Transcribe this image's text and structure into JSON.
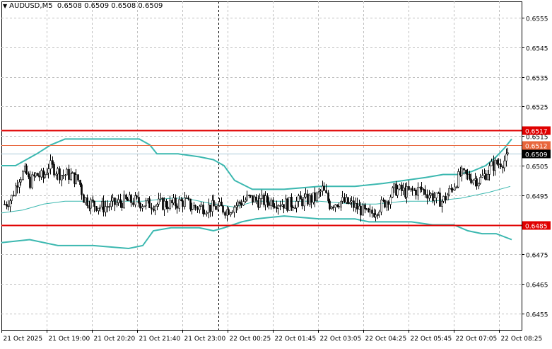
{
  "header": {
    "symbol": "AUDUSD,M5",
    "ohlc": "0.6508 0.6509 0.6508 0.6509"
  },
  "colors": {
    "background": "#ffffff",
    "grid": "#c0c0c0",
    "candle": "#000000",
    "bands": "#3cb8b0",
    "level_line": "#e00000",
    "level_line_thin": "#e8663c",
    "bid_line": "#a8c8d8"
  },
  "chart_data": {
    "type": "candlestick",
    "title": "AUDUSD,M5",
    "ylim": [
      0.64495,
      0.65605
    ],
    "grid": true,
    "y_ticks": [
      "0.6555",
      "0.6545",
      "0.6535",
      "0.6525",
      "0.6515",
      "0.6505",
      "0.6495",
      "0.6485",
      "0.6475",
      "0.6465",
      "0.6455"
    ],
    "x_ticks": [
      "21 Oct 2025",
      "21 Oct 19:00",
      "21 Oct 20:20",
      "21 Oct 21:40",
      "21 Oct 23:00",
      "22 Oct 00:25",
      "22 Oct 01:45",
      "22 Oct 03:05",
      "22 Oct 04:25",
      "22 Oct 05:45",
      "22 Oct 07:05",
      "22 Oct 08:25"
    ],
    "levels": [
      {
        "value": 0.6517,
        "label": "0.6517",
        "style": "thick"
      },
      {
        "value": 0.6512,
        "label": "0.6512",
        "style": "thin"
      },
      {
        "value": 0.6485,
        "label": "0.6485",
        "style": "thick"
      }
    ],
    "current_price": {
      "value": 0.6509,
      "label": "0.6509"
    },
    "session_separator": "21 Oct 23:00",
    "price_path": [
      [
        0,
        0.6492
      ],
      [
        10,
        0.6494
      ],
      [
        20,
        0.6501
      ],
      [
        30,
        0.6503
      ],
      [
        35,
        0.6499
      ],
      [
        45,
        0.6502
      ],
      [
        55,
        0.6501
      ],
      [
        62,
        0.6505
      ],
      [
        70,
        0.6504
      ],
      [
        80,
        0.6502
      ],
      [
        90,
        0.6502
      ],
      [
        105,
        0.65
      ],
      [
        112,
        0.6494
      ],
      [
        125,
        0.6492
      ],
      [
        140,
        0.6491
      ],
      [
        155,
        0.6492
      ],
      [
        170,
        0.6493
      ],
      [
        185,
        0.6493
      ],
      [
        200,
        0.6492
      ],
      [
        220,
        0.6492
      ],
      [
        240,
        0.6492
      ],
      [
        255,
        0.6493
      ],
      [
        265,
        0.6491
      ],
      [
        280,
        0.6491
      ],
      [
        300,
        0.6491
      ],
      [
        315,
        0.649
      ],
      [
        330,
        0.6492
      ],
      [
        345,
        0.6494
      ],
      [
        360,
        0.6493
      ],
      [
        380,
        0.6493
      ],
      [
        400,
        0.6492
      ],
      [
        420,
        0.6493
      ],
      [
        440,
        0.6494
      ],
      [
        450,
        0.6497
      ],
      [
        460,
        0.6492
      ],
      [
        475,
        0.6493
      ],
      [
        490,
        0.6492
      ],
      [
        505,
        0.649
      ],
      [
        515,
        0.6488
      ],
      [
        525,
        0.649
      ],
      [
        540,
        0.6493
      ],
      [
        552,
        0.6497
      ],
      [
        570,
        0.6496
      ],
      [
        590,
        0.6497
      ],
      [
        610,
        0.6494
      ],
      [
        620,
        0.6493
      ],
      [
        632,
        0.6497
      ],
      [
        645,
        0.6502
      ],
      [
        660,
        0.6501
      ],
      [
        672,
        0.65
      ],
      [
        680,
        0.6502
      ],
      [
        690,
        0.6505
      ],
      [
        700,
        0.6506
      ],
      [
        710,
        0.6507
      ],
      [
        715,
        0.6509
      ]
    ],
    "bollinger_upper": [
      [
        0,
        0.6505
      ],
      [
        20,
        0.6505
      ],
      [
        50,
        0.6509
      ],
      [
        70,
        0.6512
      ],
      [
        90,
        0.6514
      ],
      [
        110,
        0.6514
      ],
      [
        195,
        0.6514
      ],
      [
        210,
        0.6512
      ],
      [
        220,
        0.6509
      ],
      [
        250,
        0.6509
      ],
      [
        280,
        0.6508
      ],
      [
        300,
        0.6507
      ],
      [
        315,
        0.6505
      ],
      [
        330,
        0.65
      ],
      [
        355,
        0.6497
      ],
      [
        400,
        0.6497
      ],
      [
        450,
        0.6498
      ],
      [
        500,
        0.6498
      ],
      [
        540,
        0.6499
      ],
      [
        570,
        0.65
      ],
      [
        600,
        0.6501
      ],
      [
        625,
        0.6502
      ],
      [
        645,
        0.6502
      ],
      [
        665,
        0.6503
      ],
      [
        685,
        0.6505
      ],
      [
        700,
        0.6508
      ],
      [
        712,
        0.6511
      ],
      [
        722,
        0.6514
      ]
    ],
    "bollinger_middle": [
      [
        0,
        0.6489
      ],
      [
        30,
        0.649
      ],
      [
        60,
        0.6492
      ],
      [
        90,
        0.6493
      ],
      [
        120,
        0.6493
      ],
      [
        200,
        0.6493
      ],
      [
        240,
        0.6494
      ],
      [
        260,
        0.6494
      ],
      [
        300,
        0.6492
      ],
      [
        330,
        0.6491
      ],
      [
        360,
        0.6493
      ],
      [
        450,
        0.6493
      ],
      [
        500,
        0.6492
      ],
      [
        530,
        0.6492
      ],
      [
        570,
        0.6493
      ],
      [
        610,
        0.6493
      ],
      [
        650,
        0.6494
      ],
      [
        690,
        0.6496
      ],
      [
        720,
        0.6498
      ]
    ],
    "bollinger_lower": [
      [
        0,
        0.6479
      ],
      [
        40,
        0.648
      ],
      [
        80,
        0.6478
      ],
      [
        130,
        0.6478
      ],
      [
        180,
        0.6477
      ],
      [
        200,
        0.6478
      ],
      [
        215,
        0.6483
      ],
      [
        240,
        0.6484
      ],
      [
        280,
        0.6484
      ],
      [
        300,
        0.6483
      ],
      [
        315,
        0.6484
      ],
      [
        340,
        0.6486
      ],
      [
        360,
        0.6487
      ],
      [
        400,
        0.6488
      ],
      [
        450,
        0.6487
      ],
      [
        500,
        0.6487
      ],
      [
        520,
        0.6486
      ],
      [
        545,
        0.6486
      ],
      [
        580,
        0.6486
      ],
      [
        610,
        0.6485
      ],
      [
        640,
        0.6485
      ],
      [
        660,
        0.6483
      ],
      [
        680,
        0.6482
      ],
      [
        700,
        0.6482
      ],
      [
        722,
        0.648
      ]
    ]
  }
}
